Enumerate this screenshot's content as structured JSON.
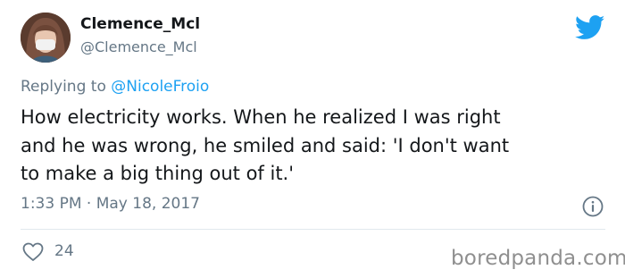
{
  "author": {
    "display_name": "Clemence_Mcl",
    "handle": "@Clemence_Mcl"
  },
  "reply": {
    "prefix": "Replying to ",
    "mention": "@NicoleFroio"
  },
  "tweet": {
    "lines": [
      "How electricity works. When he realized I was right",
      "and he was wrong, he smiled and said: 'I don't want",
      "to make a big thing out of it.'"
    ],
    "timestamp": "1:33 PM · May 18, 2017"
  },
  "engagement": {
    "likes": "24"
  },
  "watermark": "boredpanda.com",
  "icons": {
    "logo": "twitter-bird-icon",
    "info": "info-icon",
    "like": "heart-icon"
  },
  "colors": {
    "accent": "#1da1f2",
    "secondary_text": "#657786",
    "primary_text": "#14171a"
  }
}
